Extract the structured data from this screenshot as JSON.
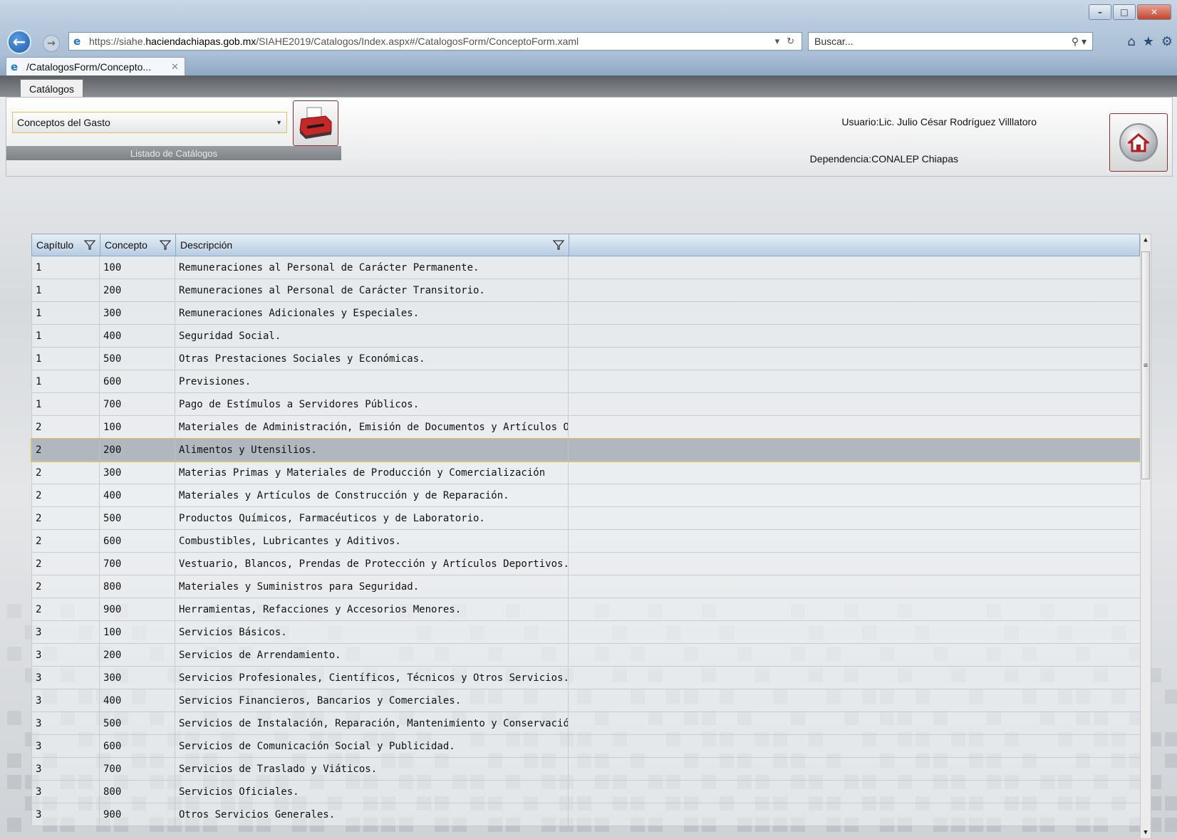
{
  "browser": {
    "url_prefix": "https://siahe.",
    "url_host": "haciendachiapas.gob.mx",
    "url_path": "/SIAHE2019/Catalogos/Index.aspx#/CatalogosForm/ConceptoForm.xaml",
    "search_placeholder": "Buscar...",
    "tab_title": "/CatalogosForm/Concepto..."
  },
  "app": {
    "tab_label": "Catálogos",
    "catalog_selected": "Conceptos del Gasto",
    "catalog_list_label": "Listado de Catálogos",
    "user_label": "Usuario:",
    "user_name": "Lic. Julio César Rodríguez Villlatoro",
    "dependency_label": "Dependencia:",
    "dependency_name": "CONALEP Chiapas"
  },
  "grid": {
    "columns": [
      "Capítulo",
      "Concepto",
      "Descripción"
    ],
    "selected_index": 8,
    "rows": [
      {
        "capitulo": "1",
        "concepto": "100",
        "descripcion": "Remuneraciones al Personal de Carácter Permanente."
      },
      {
        "capitulo": "1",
        "concepto": "200",
        "descripcion": "Remuneraciones al Personal de Carácter Transitorio."
      },
      {
        "capitulo": "1",
        "concepto": "300",
        "descripcion": "Remuneraciones Adicionales y Especiales."
      },
      {
        "capitulo": "1",
        "concepto": "400",
        "descripcion": "Seguridad Social."
      },
      {
        "capitulo": "1",
        "concepto": "500",
        "descripcion": "Otras Prestaciones Sociales y Económicas."
      },
      {
        "capitulo": "1",
        "concepto": "600",
        "descripcion": "Previsiones."
      },
      {
        "capitulo": "1",
        "concepto": "700",
        "descripcion": "Pago de Estímulos a Servidores Públicos."
      },
      {
        "capitulo": "2",
        "concepto": "100",
        "descripcion": "Materiales  de Administración, Emisión de Documentos y Artículos Oficiales."
      },
      {
        "capitulo": "2",
        "concepto": "200",
        "descripcion": "Alimentos y Utensilios."
      },
      {
        "capitulo": "2",
        "concepto": "300",
        "descripcion": "Materias Primas y Materiales de Producción y Comercialización"
      },
      {
        "capitulo": "2",
        "concepto": "400",
        "descripcion": "Materiales y Artículos de Construcción y de Reparación."
      },
      {
        "capitulo": "2",
        "concepto": "500",
        "descripcion": "Productos Químicos, Farmacéuticos y de Laboratorio."
      },
      {
        "capitulo": "2",
        "concepto": "600",
        "descripcion": "Combustibles, Lubricantes y Aditivos."
      },
      {
        "capitulo": "2",
        "concepto": "700",
        "descripcion": "Vestuario, Blancos, Prendas de Protección y Artículos Deportivos."
      },
      {
        "capitulo": "2",
        "concepto": "800",
        "descripcion": "Materiales y Suministros para Seguridad."
      },
      {
        "capitulo": "2",
        "concepto": "900",
        "descripcion": "Herramientas, Refacciones y Accesorios Menores."
      },
      {
        "capitulo": "3",
        "concepto": "100",
        "descripcion": "Servicios Básicos."
      },
      {
        "capitulo": "3",
        "concepto": "200",
        "descripcion": "Servicios de Arrendamiento."
      },
      {
        "capitulo": "3",
        "concepto": "300",
        "descripcion": "Servicios Profesionales, Científicos, Técnicos y Otros Servicios."
      },
      {
        "capitulo": "3",
        "concepto": "400",
        "descripcion": "Servicios Financieros, Bancarios y Comerciales."
      },
      {
        "capitulo": "3",
        "concepto": "500",
        "descripcion": "Servicios de Instalación, Reparación, Mantenimiento y Conservación."
      },
      {
        "capitulo": "3",
        "concepto": "600",
        "descripcion": "Servicios de Comunicación Social y Publicidad."
      },
      {
        "capitulo": "3",
        "concepto": "700",
        "descripcion": "Servicios de Traslado y Viáticos."
      },
      {
        "capitulo": "3",
        "concepto": "800",
        "descripcion": "Servicios Oficiales."
      },
      {
        "capitulo": "3",
        "concepto": "900",
        "descripcion": "Otros Servicios Generales."
      }
    ]
  }
}
